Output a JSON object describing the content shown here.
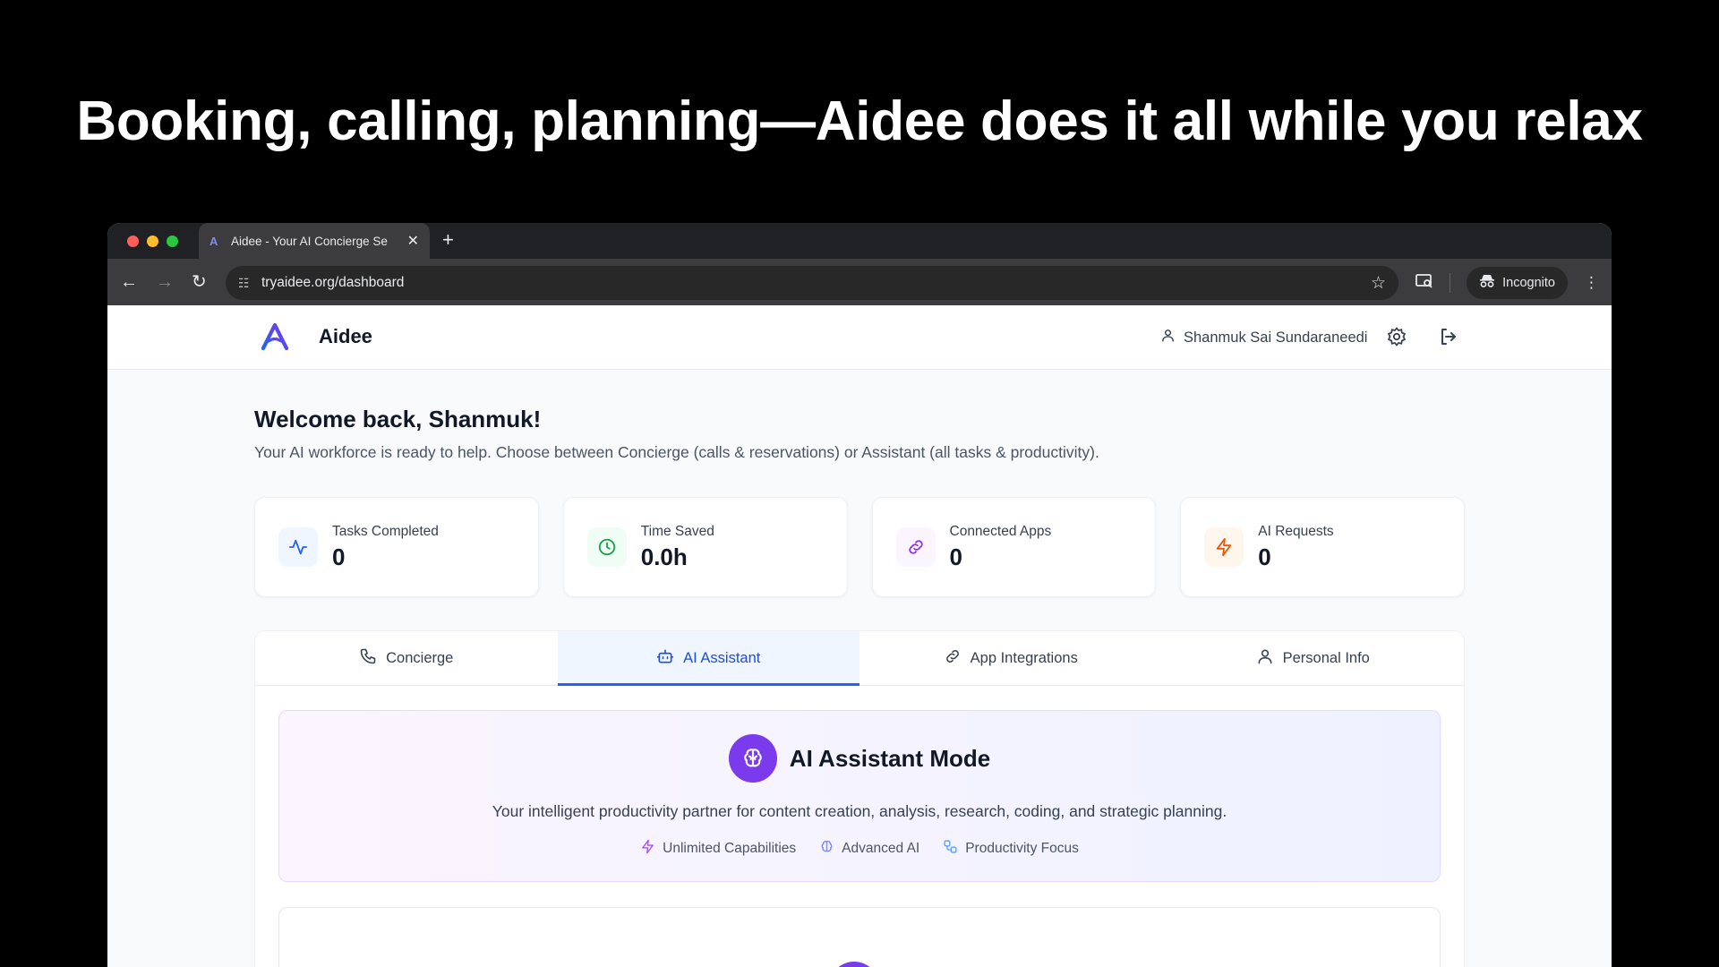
{
  "headline": "Booking, calling, planning—Aidee does it all while you relax",
  "browser": {
    "tab_title": "Aidee - Your AI Concierge Se",
    "url": "tryaidee.org/dashboard",
    "incognito_label": "Incognito"
  },
  "app": {
    "brand": "Aidee",
    "user_name": "Shanmuk Sai Sundaraneedi"
  },
  "welcome": {
    "title": "Welcome back, Shanmuk!",
    "subtitle": "Your AI workforce is ready to help. Choose between Concierge (calls & reservations) or Assistant (all tasks & productivity)."
  },
  "stats": [
    {
      "label": "Tasks Completed",
      "value": "0",
      "icon": "activity-icon",
      "color": "#2563eb",
      "bg": "#eff6ff"
    },
    {
      "label": "Time Saved",
      "value": "0.0h",
      "icon": "clock-icon",
      "color": "#16a34a",
      "bg": "#f0fdf4"
    },
    {
      "label": "Connected Apps",
      "value": "0",
      "icon": "link-icon",
      "color": "#9333ea",
      "bg": "#faf5ff"
    },
    {
      "label": "AI Requests",
      "value": "0",
      "icon": "zap-icon",
      "color": "#ea580c",
      "bg": "#fff7ed"
    }
  ],
  "tabs": [
    {
      "label": "Concierge",
      "icon": "phone-icon"
    },
    {
      "label": "AI Assistant",
      "icon": "bot-icon",
      "active": true
    },
    {
      "label": "App Integrations",
      "icon": "link-icon"
    },
    {
      "label": "Personal Info",
      "icon": "user-icon"
    }
  ],
  "mode": {
    "title": "AI Assistant Mode",
    "description": "Your intelligent productivity partner for content creation, analysis, research, coding, and strategic planning.",
    "features": [
      {
        "label": "Unlimited Capabilities",
        "icon": "zap-icon"
      },
      {
        "label": "Advanced AI",
        "icon": "brain-icon"
      },
      {
        "label": "Productivity Focus",
        "icon": "workflow-icon"
      }
    ]
  },
  "colors": {
    "accent": "#2563eb",
    "purple": "#7c3aed"
  }
}
